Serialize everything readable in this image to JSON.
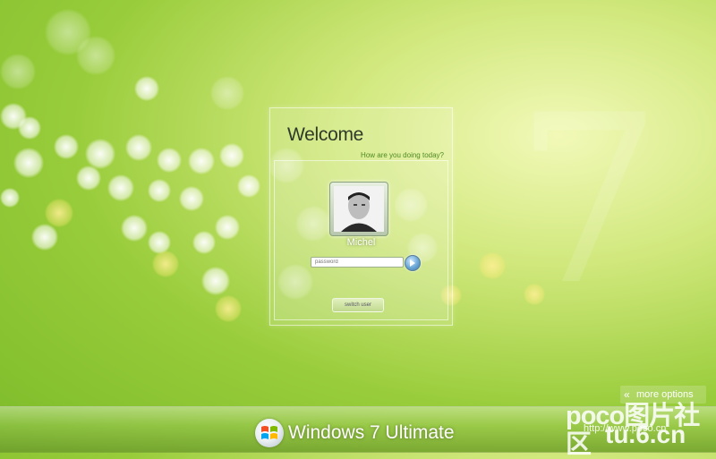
{
  "login": {
    "title": "Welcome",
    "subtitle": "How are you doing today?",
    "user_name": "Michel",
    "password_placeholder": "password",
    "switch_user_label": "switch user"
  },
  "bottom": {
    "more_options_label": "more options",
    "edition_label": "Windows 7 Ultimate"
  },
  "watermark": {
    "line1": "poco图片社区",
    "line2": "http://www.poco.cn",
    "line3": "tu.6.cn"
  },
  "colors": {
    "background_accent": "#98cc3a",
    "subtitle_text": "#4f8a22",
    "go_button": "#6aa6d6"
  },
  "icons": {
    "go": "arrow-right-circle-icon",
    "more_options": "double-chevron-left-icon",
    "logo": "windows-flag-icon"
  }
}
